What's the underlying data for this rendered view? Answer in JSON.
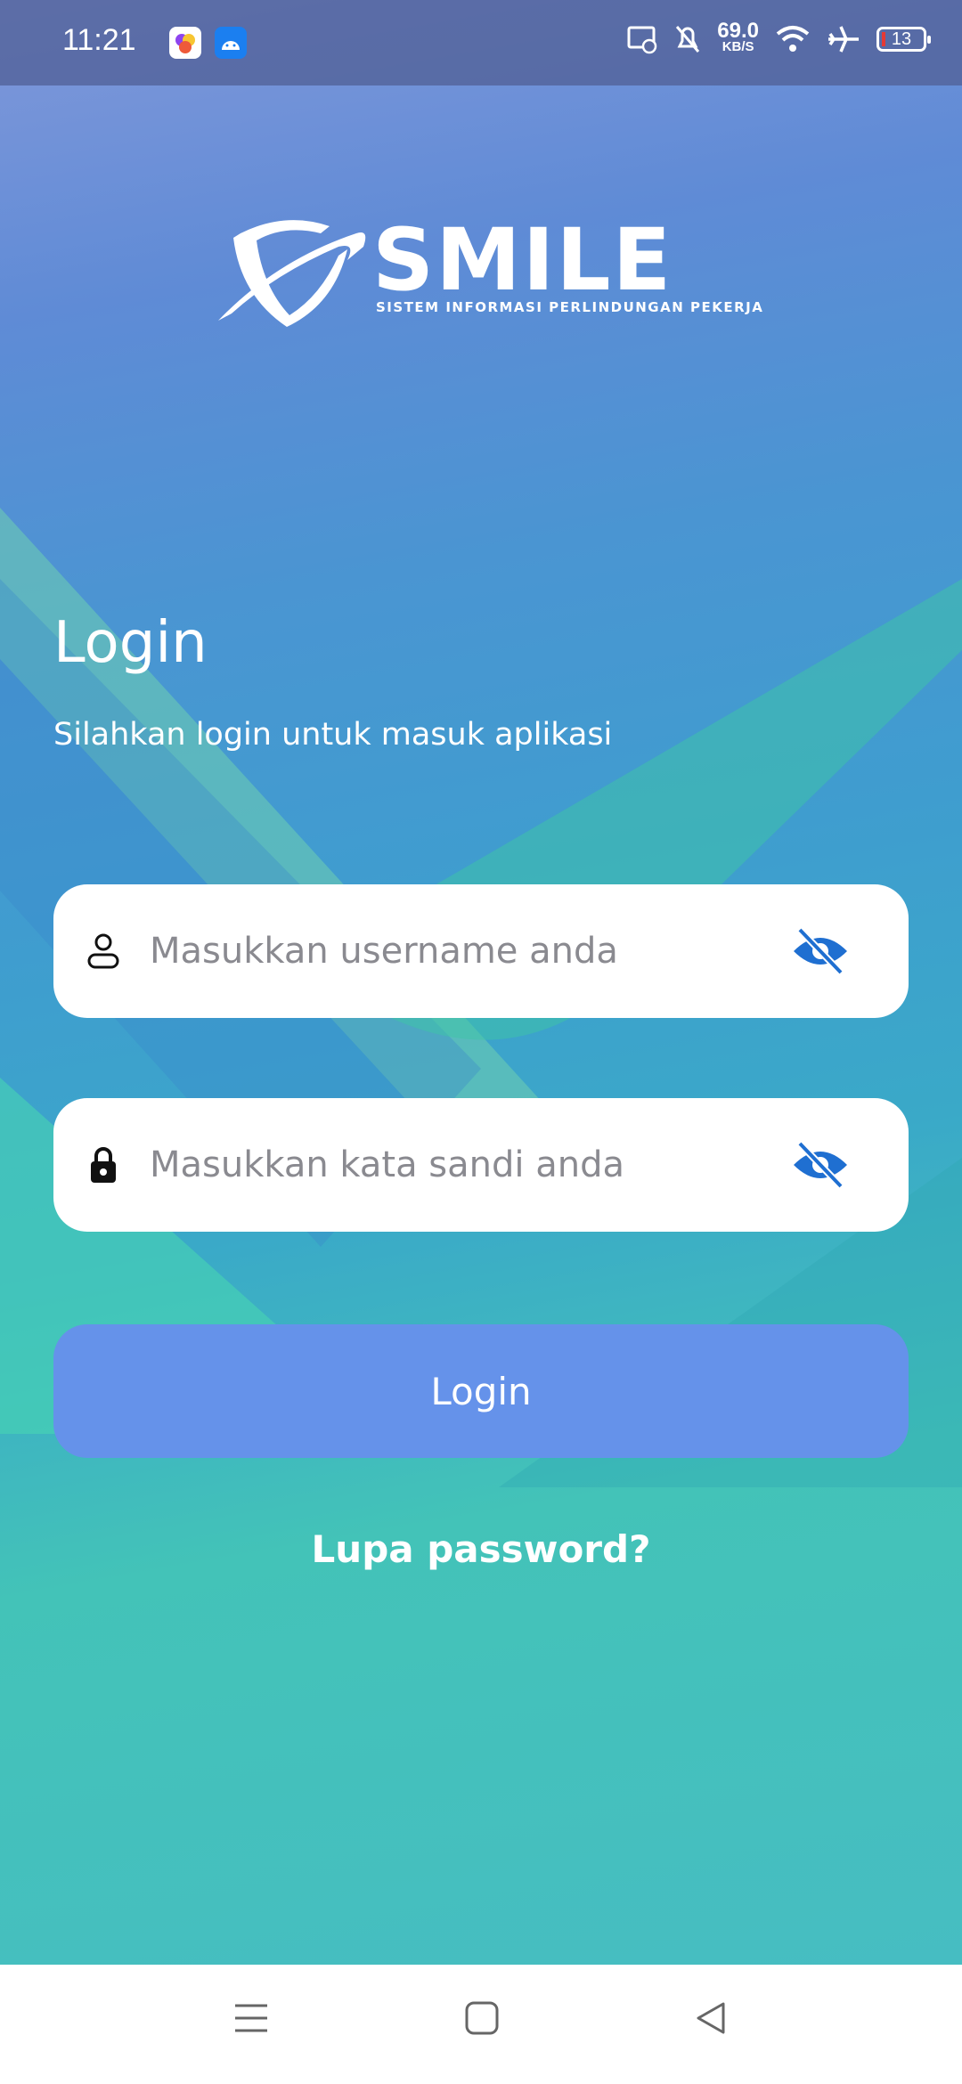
{
  "status_bar": {
    "time": "11:21",
    "net_speed_value": "69.0",
    "net_speed_unit": "KB/S",
    "battery": "13"
  },
  "logo": {
    "name": "SMILE",
    "tagline": "SISTEM INFORMASI PERLINDUNGAN PEKERJA"
  },
  "login": {
    "title": "Login",
    "subtitle": "Silahkan login untuk masuk aplikasi",
    "username_placeholder": "Masukkan username anda",
    "password_placeholder": "Masukkan kata sandi anda",
    "button_label": "Login",
    "forgot_label": "Lupa password?"
  },
  "colors": {
    "button": "#6592ea",
    "eye_icon": "#1f6fd1"
  },
  "icons": [
    "user-icon",
    "lock-icon",
    "eye-off-icon",
    "menu-icon",
    "home-icon",
    "back-icon"
  ]
}
